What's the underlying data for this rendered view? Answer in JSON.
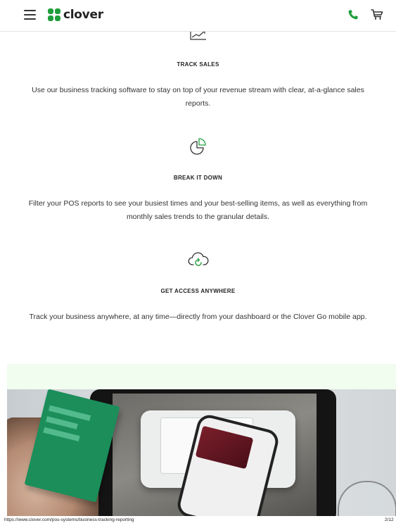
{
  "header": {
    "logo_text": "clover",
    "icons": {
      "menu": "hamburger-menu-icon",
      "logo": "clover-logo-icon",
      "phone": "phone-icon",
      "cart": "shopping-cart-icon"
    }
  },
  "features": [
    {
      "icon": "line-chart-icon",
      "title": "TRACK SALES",
      "description": "Use our business tracking software to stay on top of your revenue stream with clear, at-a-glance sales reports."
    },
    {
      "icon": "pie-chart-icon",
      "title": "BREAK IT DOWN",
      "description": "Filter your POS reports to see your busiest times and your best-selling items, as well as everything from monthly sales trends to the granular details."
    },
    {
      "icon": "cloud-sync-icon",
      "title": "GET ACCESS ANYWHERE",
      "description": "Track your business anywhere, at any time—directly from your dashboard or the Clover Go mobile app."
    }
  ],
  "photo": {
    "alt": "photo of payment terminal with phone and credit card"
  },
  "status_bar": {
    "url": "https://www.clover.com/pos-systems/business-tracking-reporting",
    "page": "2/12"
  },
  "colors": {
    "brand_green": "#1e9e3a",
    "band_green": "#f1fdef",
    "text": "#333333"
  }
}
